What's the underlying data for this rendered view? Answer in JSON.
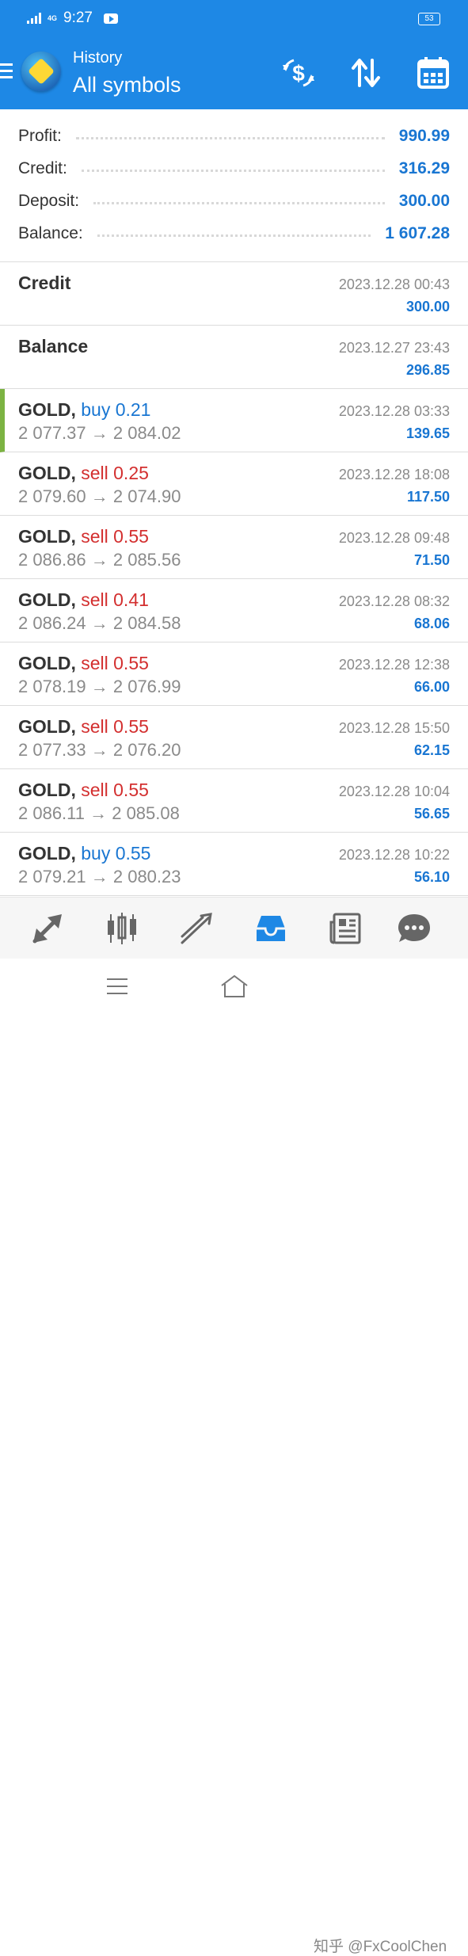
{
  "status_bar": {
    "time": "9:27",
    "network": "4G",
    "battery": "53"
  },
  "header": {
    "subtitle": "History",
    "title": "All symbols",
    "icons": [
      "menu-icon",
      "metatrader-logo",
      "currency-exchange-icon",
      "sort-icon",
      "calendar-icon"
    ]
  },
  "summary": {
    "profit": {
      "label": "Profit:",
      "value": "990.99"
    },
    "credit": {
      "label": "Credit:",
      "value": "316.29"
    },
    "deposit": {
      "label": "Deposit:",
      "value": "300.00"
    },
    "balance": {
      "label": "Balance:",
      "value": "1 607.28"
    }
  },
  "operations": [
    {
      "label": "Credit",
      "time": "2023.12.28 00:43",
      "amount": "300.00"
    },
    {
      "label": "Balance",
      "time": "2023.12.27 23:43",
      "amount": "296.85"
    }
  ],
  "trades": [
    {
      "symbol": "GOLD,",
      "side": "buy 0.21",
      "prices": "2 077.37 → 2 084.02",
      "time": "2023.12.28 03:33",
      "profit": "139.65"
    },
    {
      "symbol": "GOLD,",
      "side": "sell 0.25",
      "prices": "2 079.60 → 2 074.90",
      "time": "2023.12.28 18:08",
      "profit": "117.50"
    },
    {
      "symbol": "GOLD,",
      "side": "sell 0.55",
      "prices": "2 086.86 → 2 085.56",
      "time": "2023.12.28 09:48",
      "profit": "71.50"
    },
    {
      "symbol": "GOLD,",
      "side": "sell 0.41",
      "prices": "2 086.24 → 2 084.58",
      "time": "2023.12.28 08:32",
      "profit": "68.06"
    },
    {
      "symbol": "GOLD,",
      "side": "sell 0.55",
      "prices": "2 078.19 → 2 076.99",
      "time": "2023.12.28 12:38",
      "profit": "66.00"
    },
    {
      "symbol": "GOLD,",
      "side": "sell 0.55",
      "prices": "2 077.33 → 2 076.20",
      "time": "2023.12.28 15:50",
      "profit": "62.15"
    },
    {
      "symbol": "GOLD,",
      "side": "sell 0.55",
      "prices": "2 086.11 → 2 085.08",
      "time": "2023.12.28 10:04",
      "profit": "56.65"
    },
    {
      "symbol": "GOLD,",
      "side": "buy 0.55",
      "prices": "2 079.21 → 2 080.23",
      "time": "2023.12.28 10:22",
      "profit": "56.10"
    }
  ],
  "bottom_nav": [
    "quotes-icon",
    "chart-icon",
    "trade-icon",
    "history-icon",
    "news-icon",
    "chat-icon"
  ],
  "system_nav": [
    "recents-icon",
    "home-icon",
    "back-icon"
  ],
  "watermark": "知乎 @FxCoolChen",
  "colors": {
    "header": "#1e88e5",
    "buy": "#1976d2",
    "sell": "#d32f2f",
    "profit": "#1976d2",
    "selected_marker": "#7cb342"
  }
}
